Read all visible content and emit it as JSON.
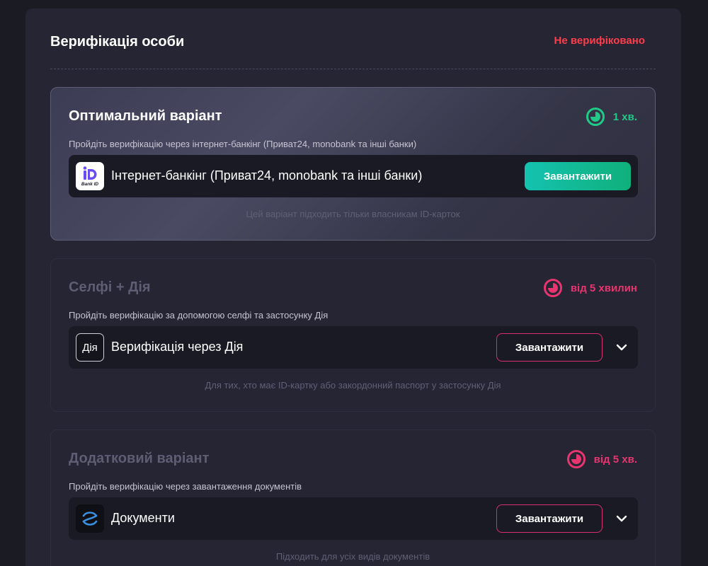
{
  "page": {
    "title": "Верифікація особи",
    "status": "Не верифіковано",
    "status_color": "#ff3d4b"
  },
  "options": [
    {
      "title": "Оптимальний варіант",
      "time": "1 хв.",
      "time_color": "#1fcb86",
      "subtitle": "Пройдіть верифікацію через інтернет-банкінг (Приват24, monobank та інші банки)",
      "method_label": "Інтернет-банкінг (Приват24, monobank та інші банки)",
      "method_icon": "bankid-icon",
      "logo_text": "Bank ID",
      "button_label": "Завантажити",
      "note": "Цей варіант підходить тільки власникам ID-карток"
    },
    {
      "title": "Селфі + Дія",
      "time": "від 5 хвилин",
      "time_color": "#e8356f",
      "subtitle": "Пройдіть верифікацію за допомогою селфі та застосунку Дія",
      "method_label": "Верифікація через Дія",
      "method_icon": "diia-icon",
      "logo_text": "Дія",
      "button_label": "Завантажити",
      "note": "Для тих, хто має ID-картку або закордонний паспорт у застосунку Дія"
    },
    {
      "title": "Додатковий варіант",
      "time": "від 5 хв.",
      "time_color": "#e8356f",
      "subtitle": "Пройдіть верифікацію через завантаження документів",
      "method_label": "Документи",
      "method_icon": "documents-icon",
      "button_label": "Завантажити",
      "note": "Підходить для усіх видів документів"
    }
  ]
}
